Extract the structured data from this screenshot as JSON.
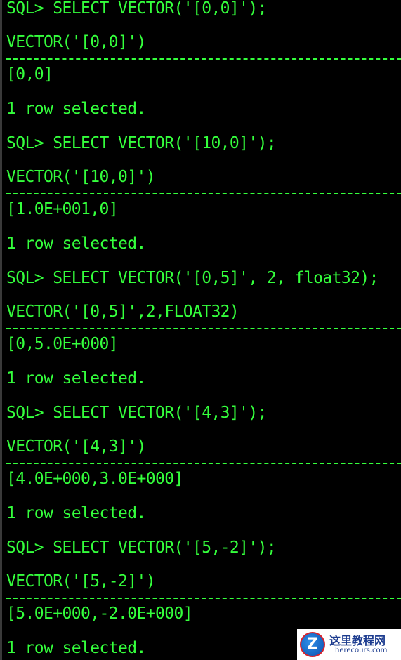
{
  "session": {
    "blocks": [
      {
        "command": "SQL> SELECT VECTOR('[0,0]');",
        "column_header": "VECTOR('[0,0]')",
        "result": "[0,0]",
        "status": "1 row selected."
      },
      {
        "command": "SQL> SELECT VECTOR('[10,0]');",
        "column_header": "VECTOR('[10,0]')",
        "result": "[1.0E+001,0]",
        "status": "1 row selected."
      },
      {
        "command": "SQL> SELECT VECTOR('[0,5]', 2, float32);",
        "column_header": "VECTOR('[0,5]',2,FLOAT32)",
        "result": "[0,5.0E+000]",
        "status": "1 row selected."
      },
      {
        "command": "SQL> SELECT VECTOR('[4,3]');",
        "column_header": "VECTOR('[4,3]')",
        "result": "[4.0E+000,3.0E+000]",
        "status": "1 row selected."
      },
      {
        "command": "SQL> SELECT VECTOR('[5,-2]');",
        "column_header": "VECTOR('[5,-2]')",
        "result": "[5.0E+000,-2.0E+000]",
        "status": "1 row selected."
      }
    ]
  },
  "watermark": {
    "letter": "Z",
    "title": "这里教程网",
    "subtitle": "herecours.com"
  },
  "colors": {
    "terminal_text": "#34ff3c",
    "background": "#000000"
  }
}
